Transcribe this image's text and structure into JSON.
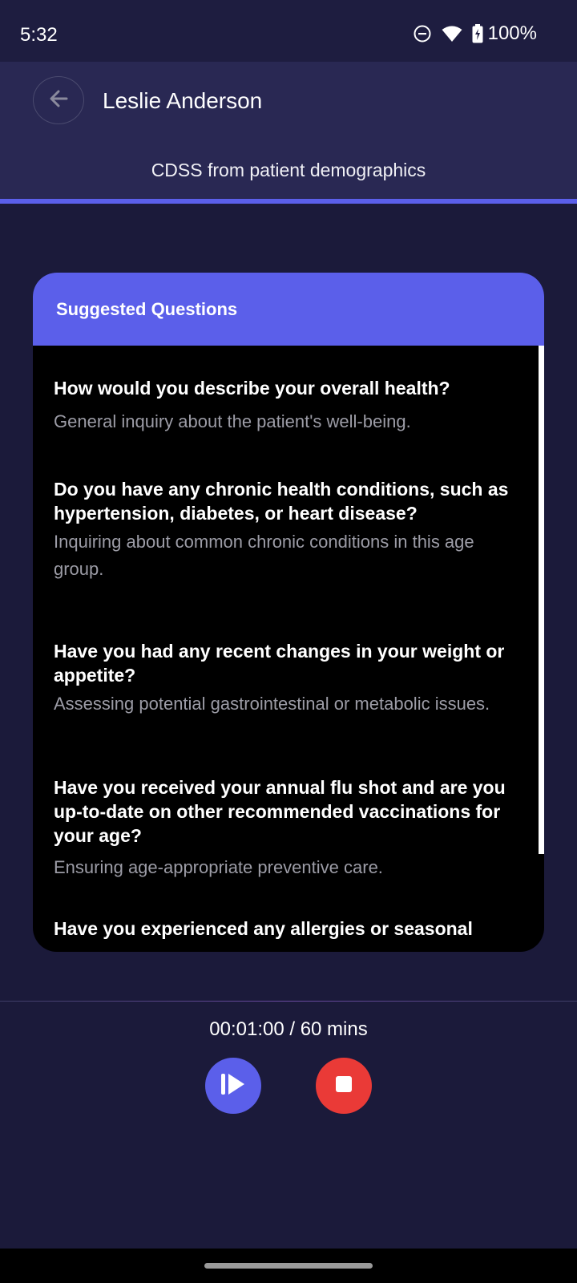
{
  "status_bar": {
    "time": "5:32",
    "battery": "100%"
  },
  "header": {
    "title": "Leslie Anderson",
    "subtitle": "CDSS from patient demographics"
  },
  "card": {
    "title": "Suggested Questions",
    "questions": [
      {
        "title": "How would you describe your overall health?",
        "description": "General inquiry about the patient's well-being."
      },
      {
        "title": "Do you have any chronic health conditions, such as hypertension, diabetes, or heart disease?",
        "description": "Inquiring about common chronic conditions in this age group."
      },
      {
        "title": "Have you had any recent changes in your weight or appetite?",
        "description": "Assessing potential gastrointestinal or metabolic issues."
      },
      {
        "title": "Have you received your annual flu shot and are you up-to-date on other recommended vaccinations for your age?",
        "description": "Ensuring age-appropriate preventive care."
      },
      {
        "title": "Have you experienced any allergies or seasonal",
        "description": ""
      }
    ]
  },
  "recorder": {
    "timer": "00:01:00 / 60 mins"
  },
  "colors": {
    "background": "#1b1a3a",
    "header": "#292853",
    "accent": "#5b5fea",
    "stop": "#ea3a37"
  },
  "icons": {
    "back": "arrow-left-icon",
    "play": "play-pause-icon",
    "stop": "stop-icon",
    "dnd": "do-not-disturb-icon",
    "wifi": "wifi-icon",
    "battery": "battery-charging-icon"
  }
}
